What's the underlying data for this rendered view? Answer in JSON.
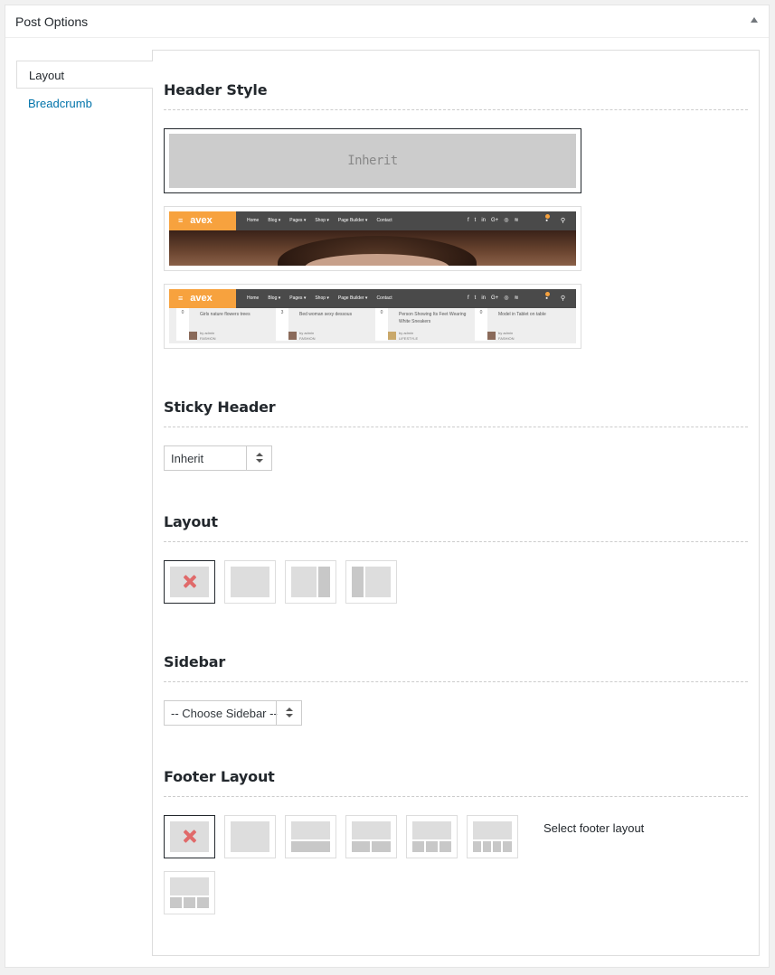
{
  "box": {
    "title": "Post Options"
  },
  "tabs": [
    {
      "label": "Layout",
      "active": true
    },
    {
      "label": "Breadcrumb",
      "active": false
    }
  ],
  "header_style": {
    "title": "Header Style",
    "inherit_label": "Inherit",
    "nav": {
      "logo": "avex",
      "links": [
        "Home",
        "Blog ▾",
        "Pages ▾",
        "Shop ▾",
        "Page Builder ▾",
        "Contact"
      ],
      "social": [
        "f",
        "t",
        "in",
        "G+",
        "◎",
        "≋"
      ]
    },
    "posts": [
      {
        "count": "0",
        "title": "Girls nature flowers trees",
        "author": "by admin",
        "category": "FASHION"
      },
      {
        "count": "3",
        "title": "Bed woman sexy dessous",
        "author": "by admin",
        "category": "FASHION"
      },
      {
        "count": "0",
        "title": "Person Showing Its Feet Wearing White Sneakers",
        "author": "by admin",
        "category": "LIFESTYLE"
      },
      {
        "count": "0",
        "title": "Model in Tablet on table",
        "author": "by admin",
        "category": "FASHION"
      }
    ]
  },
  "sticky_header": {
    "title": "Sticky Header",
    "value": "Inherit"
  },
  "layout": {
    "title": "Layout"
  },
  "sidebar": {
    "title": "Sidebar",
    "value": "-- Choose Sidebar --"
  },
  "footer_layout": {
    "title": "Footer Layout",
    "note": "Select footer layout"
  },
  "colors": {
    "accent": "#f7a23e",
    "link": "#0073aa",
    "nav_bg": "#4a4a4a",
    "remove_x": "#e06a6a"
  }
}
